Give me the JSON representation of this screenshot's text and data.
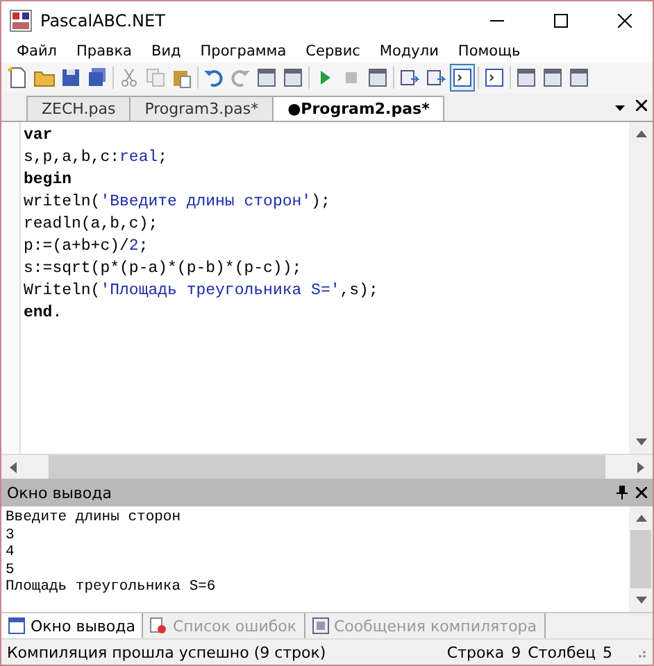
{
  "window": {
    "title": "PascalABC.NET"
  },
  "menu": [
    "Файл",
    "Правка",
    "Вид",
    "Программа",
    "Сервис",
    "Модули",
    "Помощь"
  ],
  "toolbar": [
    {
      "kind": "new",
      "selected": false
    },
    {
      "kind": "open",
      "selected": false
    },
    {
      "kind": "save",
      "selected": false
    },
    {
      "kind": "saveall",
      "selected": false
    },
    {
      "kind": "sep"
    },
    {
      "kind": "cut",
      "selected": false
    },
    {
      "kind": "copy",
      "selected": false
    },
    {
      "kind": "paste",
      "selected": false
    },
    {
      "kind": "sep"
    },
    {
      "kind": "undo",
      "selected": false
    },
    {
      "kind": "redo",
      "selected": false
    },
    {
      "kind": "window",
      "selected": false
    },
    {
      "kind": "window",
      "selected": false
    },
    {
      "kind": "sep"
    },
    {
      "kind": "run",
      "selected": false
    },
    {
      "kind": "stop",
      "selected": false
    },
    {
      "kind": "window",
      "selected": false
    },
    {
      "kind": "sep"
    },
    {
      "kind": "step",
      "selected": false
    },
    {
      "kind": "step",
      "selected": false
    },
    {
      "kind": "console",
      "selected": true
    },
    {
      "kind": "sep"
    },
    {
      "kind": "console",
      "selected": false
    },
    {
      "kind": "sep"
    },
    {
      "kind": "window",
      "selected": false
    },
    {
      "kind": "window",
      "selected": false
    },
    {
      "kind": "window",
      "selected": false
    }
  ],
  "tabs": [
    {
      "label": "ZECH.pas",
      "selected": false
    },
    {
      "label": "Program3.pas*",
      "selected": false
    },
    {
      "label": "●Program2.pas*",
      "selected": true
    }
  ],
  "editor": {
    "lines": [
      [
        {
          "text": "var",
          "kind": "keyword"
        }
      ],
      [
        {
          "text": "s,p,a,b,c:",
          "kind": "plain"
        },
        {
          "text": "real",
          "kind": "type"
        },
        {
          "text": ";",
          "kind": "plain"
        }
      ],
      [
        {
          "text": "begin",
          "kind": "keyword"
        }
      ],
      [
        {
          "text": "writeln(",
          "kind": "plain"
        },
        {
          "text": "'Введите длины сторон'",
          "kind": "string"
        },
        {
          "text": ");",
          "kind": "plain"
        }
      ],
      [
        {
          "text": "readln(a,b,c);",
          "kind": "plain"
        }
      ],
      [
        {
          "text": "p:=(a+b+c)/",
          "kind": "plain"
        },
        {
          "text": "2",
          "kind": "number"
        },
        {
          "text": ";",
          "kind": "plain"
        }
      ],
      [
        {
          "text": "s:=sqrt(p*(p-a)*(p-b)*(p-c));",
          "kind": "plain"
        }
      ],
      [
        {
          "text": "Writeln(",
          "kind": "plain"
        },
        {
          "text": "'Площадь треугольника S='",
          "kind": "string"
        },
        {
          "text": ",s);",
          "kind": "plain"
        }
      ],
      [
        {
          "text": "end",
          "kind": "keyword"
        },
        {
          "text": ".",
          "kind": "plain"
        }
      ]
    ]
  },
  "output": {
    "title": "Окно вывода",
    "lines": [
      "Введите длины сторон",
      "3",
      "4",
      "5",
      "Площадь треугольника S=6"
    ]
  },
  "bottom_tabs": [
    {
      "label": "Окно вывода",
      "kind": "output",
      "selected": true
    },
    {
      "label": "Список ошибок",
      "kind": "errors",
      "selected": false
    },
    {
      "label": "Сообщения компилятора",
      "kind": "messages",
      "selected": false
    }
  ],
  "status_bar": {
    "message": "Компиляция прошла успешно (9 строк)",
    "line_label": "Строка",
    "line": "9",
    "column_label": "Столбец",
    "column": "5"
  }
}
